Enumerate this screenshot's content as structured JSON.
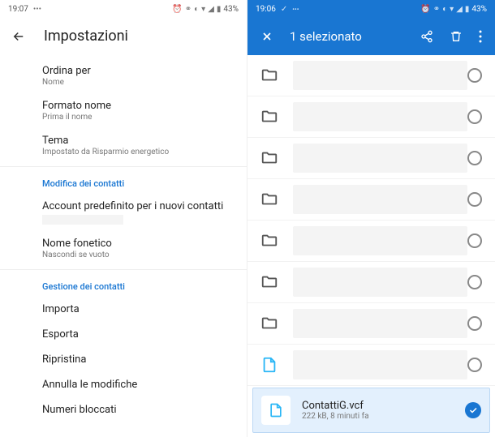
{
  "left": {
    "status": {
      "time": "19:07",
      "battery": "43%"
    },
    "title": "Impostazioni",
    "items": [
      {
        "title": "Ordina per",
        "sub": "Nome"
      },
      {
        "title": "Formato nome",
        "sub": "Prima il nome"
      },
      {
        "title": "Tema",
        "sub": "Impostato da Risparmio energetico"
      }
    ],
    "section1": "Modifica dei contatti",
    "items2": [
      {
        "title": "Account predefinito per i nuovi contatti",
        "sub": ""
      },
      {
        "title": "Nome fonetico",
        "sub": "Nascondi se vuoto"
      }
    ],
    "section2": "Gestione dei contatti",
    "items3": [
      {
        "title": "Importa"
      },
      {
        "title": "Esporta"
      },
      {
        "title": "Ripristina"
      },
      {
        "title": "Annulla le modifiche"
      },
      {
        "title": "Numeri bloccati"
      }
    ]
  },
  "right": {
    "status": {
      "time": "19:06",
      "battery": "43%"
    },
    "title": "1 selezionato",
    "selected": {
      "name": "ContattiG.vcf",
      "meta": "222 kB, 8 minuti fa"
    }
  }
}
